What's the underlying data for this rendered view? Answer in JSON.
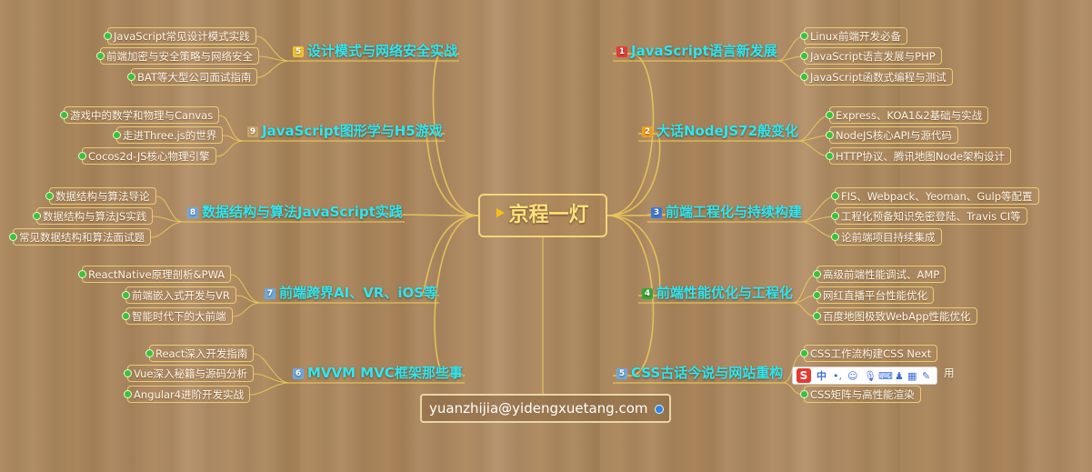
{
  "center": {
    "title": "京程一灯"
  },
  "email": "yuanzhijia@yidengxuetang.com",
  "colors": {
    "branch_text": "#2fe6f2",
    "center_text": "#ffe27a",
    "line": "#e8c85a",
    "leaf_dot": "#3fbf3a"
  },
  "left_branches": [
    {
      "num": "5",
      "num_color": "#f1c232",
      "label": "设计模式与网络安全实战",
      "items": [
        "JavaScript常见设计模式实践",
        "前端加密与安全策略与网络安全",
        "BAT等大型公司面试指南"
      ]
    },
    {
      "num": "9",
      "num_color": "#c9a46a",
      "label": "JavaScript图形学与H5游戏",
      "items": [
        "游戏中的数学和物理与Canvas",
        "走进Three.js的世界",
        "Cocos2d-JS核心物理引擎"
      ]
    },
    {
      "num": "8",
      "num_color": "#6fa8dc",
      "label": "数据结构与算法JavaScript实践",
      "items": [
        "数据结构与算法导论",
        "数据结构与算法JS实践",
        "常见数据结构和算法面试题"
      ]
    },
    {
      "num": "7",
      "num_color": "#6fa8dc",
      "label": "前端跨界AI、VR、iOS等",
      "items": [
        "ReactNative原理剖析&PWA",
        "前端嵌入式开发与VR",
        "智能时代下的大前端"
      ]
    },
    {
      "num": "6",
      "num_color": "#6fa8dc",
      "label": "MVVM MVC框架那些事",
      "items": [
        "React深入开发指南",
        "Vue深入秘籍与源码分析",
        "Angular4进阶开发实战"
      ]
    }
  ],
  "right_branches": [
    {
      "num": "1",
      "num_color": "#e03c3c",
      "label": "JavaScript语言新发展",
      "items": [
        "Linux前端开发必备",
        "JavaScript语言发展与PHP",
        "JavaScript函数式编程与测试"
      ]
    },
    {
      "num": "2",
      "num_color": "#f0a020",
      "label": "大话NodeJS72般变化",
      "items": [
        "Express、KOA1&2基础与实战",
        "NodeJS核心API与源代码",
        "HTTP协议、腾讯地图Node架构设计"
      ]
    },
    {
      "num": "3",
      "num_color": "#3c78d8",
      "label": "前端工程化与持续构建",
      "items": [
        "FIS、Webpack、Yeoman、Gulp等配置",
        "工程化预备知识免密登陆、Travis CI等",
        "论前端项目持续集成"
      ]
    },
    {
      "num": "4",
      "num_color": "#38a838",
      "label": "前端性能优化与工程化",
      "items": [
        "高级前端性能调试、AMP",
        "网红直播平台性能优化",
        "百度地图极致WebApp性能优化"
      ]
    },
    {
      "num": "5",
      "num_color": "#6fa8dc",
      "label": "CSS古话今说与网站重构",
      "items": [
        "CSS工作流构建CSS Next",
        "用",
        "CSS矩阵与高性能渲染"
      ]
    }
  ],
  "ime_toolbar": {
    "logo": "S",
    "mode": "中",
    "icons": [
      "punctuation-icon",
      "emoji-icon",
      "microphone-icon",
      "keyboard-icon",
      "skin-icon",
      "apps-icon",
      "wrench-icon"
    ]
  }
}
